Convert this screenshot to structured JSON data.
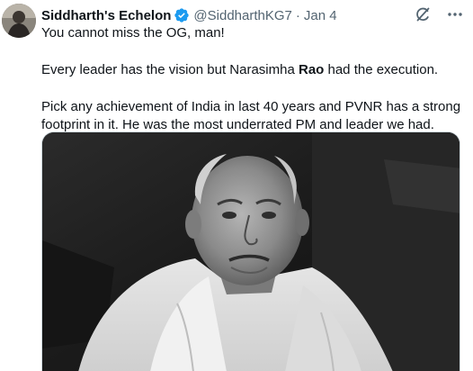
{
  "author": {
    "display_name": "Siddharth's Echelon",
    "handle": "@SiddharthKG7",
    "separator": "·",
    "date": "Jan 4",
    "verified": true
  },
  "tweet": {
    "line1": "You cannot miss the OG, man!",
    "line2_pre": "Every leader has the vision but Narasimha ",
    "line2_bold": "Rao",
    "line2_post": " had the execution.",
    "line3": "Pick any achievement of India in last 40 years and PVNR has a strong footprint in it. He was the most underrated PM and leader we had."
  },
  "icons": {
    "verified": "verified-badge-icon",
    "grok": "grok-icon",
    "more": "more-options-icon"
  },
  "colors": {
    "accent": "#1d9bf0",
    "text": "#0f1419",
    "secondary": "#536471"
  },
  "media": {
    "kind": "black-and-white photo of an elderly man in a white kurta"
  }
}
